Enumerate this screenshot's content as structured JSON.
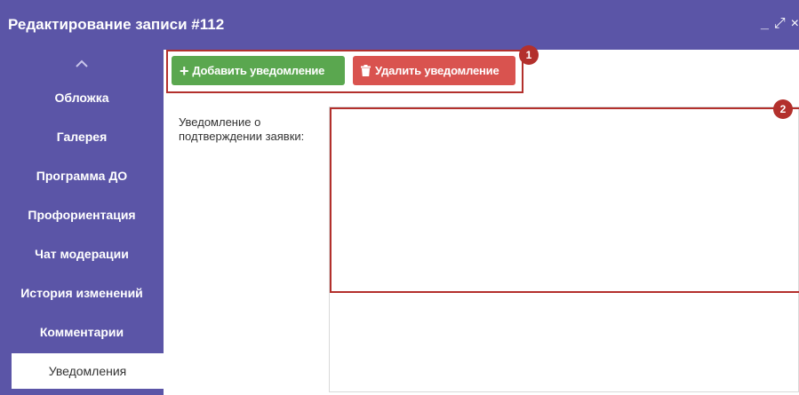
{
  "window": {
    "title": "Редактирование записи #112",
    "controls": {
      "minimize": "_",
      "maximize": "⤢",
      "close": "×"
    }
  },
  "sidebar": {
    "collapse_icon": "chevron-up-icon",
    "items": [
      {
        "label": "Обложка",
        "active": false
      },
      {
        "label": "Галерея",
        "active": false
      },
      {
        "label": "Программа ДО",
        "active": false
      },
      {
        "label": "Профориентация",
        "active": false
      },
      {
        "label": "Чат модерации",
        "active": false
      },
      {
        "label": "История изменений",
        "active": false
      },
      {
        "label": "Комментарии",
        "active": false
      },
      {
        "label": "Уведомления",
        "active": true
      }
    ]
  },
  "toolbar": {
    "add_label": "Добавить уведомление",
    "add_icon": "plus-icon",
    "delete_label": "Удалить уведомление",
    "delete_icon": "trash-icon"
  },
  "form": {
    "notification_label": "Уведомление о подтверждении заявки:",
    "notification_value": ""
  },
  "annotations": {
    "marker_1": "1",
    "marker_2": "2"
  },
  "colors": {
    "sidebar_bg": "#5b55a7",
    "add_button": "#5aa74f",
    "delete_button": "#d9534f",
    "highlight": "#b3302c"
  }
}
